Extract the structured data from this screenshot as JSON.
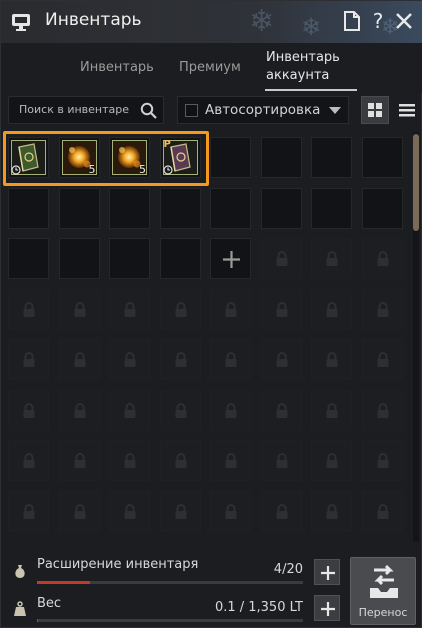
{
  "window": {
    "title": "Инвентарь"
  },
  "tabs": [
    {
      "label": "Инвентарь",
      "active": false
    },
    {
      "label": "Премиум",
      "active": false
    },
    {
      "label": "Инвентарь",
      "label2": "аккаунта",
      "active": true
    }
  ],
  "toolbar": {
    "search_placeholder": "Поиск в инвентаре",
    "autosort_label": "Автосортировка"
  },
  "items": [
    {
      "name": "green-book-item",
      "kind": "book",
      "color": "#3d5a2a",
      "timed": true,
      "qty": "",
      "tag": ""
    },
    {
      "name": "golden-orb-item",
      "kind": "orb",
      "color": "#c8781a",
      "timed": false,
      "qty": "5",
      "tag": ""
    },
    {
      "name": "golden-orb-item",
      "kind": "orb",
      "color": "#c8781a",
      "timed": false,
      "qty": "5",
      "tag": ""
    },
    {
      "name": "purple-book-item",
      "kind": "book",
      "color": "#5a3a52",
      "timed": true,
      "qty": "",
      "tag": "P"
    }
  ],
  "grid": {
    "columns": 8,
    "rows": 8,
    "open_slots": 20,
    "add_slot_index": 20
  },
  "bottom": {
    "expansion_label": "Расширение инвентаря",
    "expansion_value": "4/20",
    "expansion_fraction": 0.2,
    "weight_label": "Вес",
    "weight_value": "0.1 / 1,350 LT",
    "weight_fraction": 0.0001,
    "transfer_label": "Перенос"
  },
  "colors": {
    "highlight": "#f39a1e",
    "progress_fill": "#c0392b"
  }
}
